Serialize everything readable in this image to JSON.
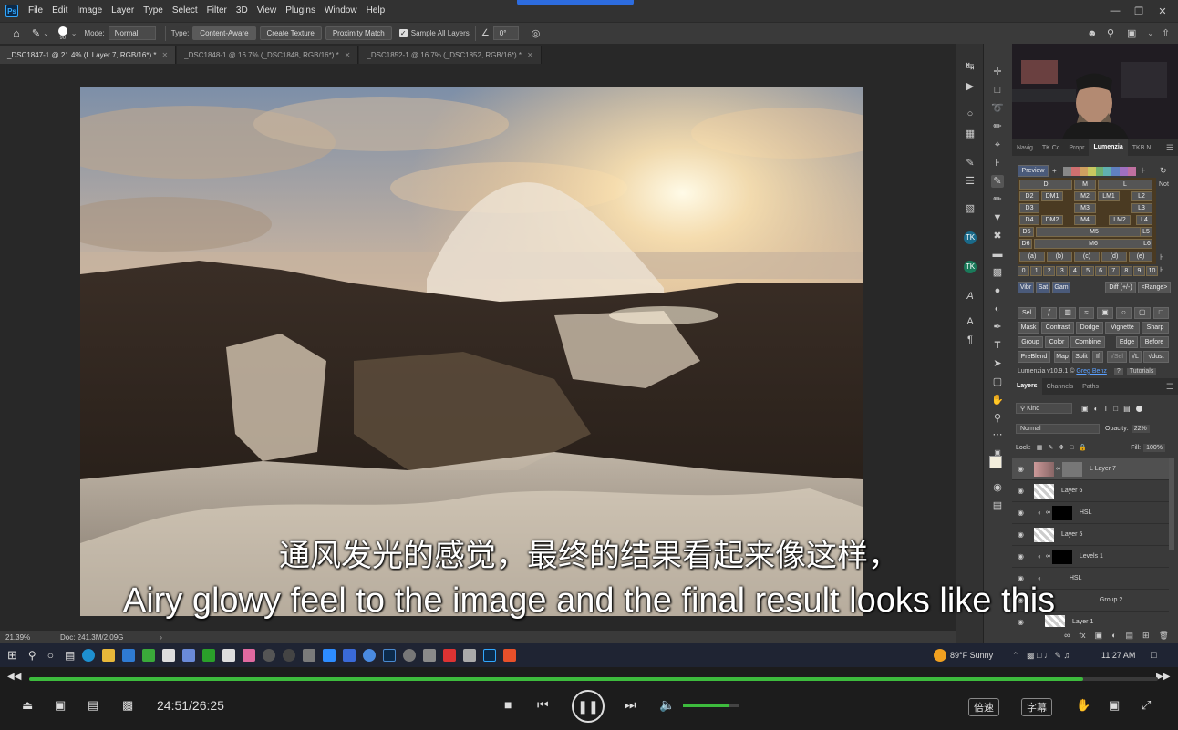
{
  "menu": {
    "logo": "Ps",
    "items": [
      "File",
      "Edit",
      "Image",
      "Layer",
      "Type",
      "Select",
      "Filter",
      "3D",
      "View",
      "Plugins",
      "Window",
      "Help"
    ]
  },
  "options": {
    "brush_size": "90",
    "mode_label": "Mode:",
    "mode_value": "Normal",
    "type_label": "Type:",
    "content_aware": "Content-Aware",
    "create_texture": "Create Texture",
    "proximity_match": "Proximity Match",
    "sample_all_layers": "Sample All Layers",
    "angle_value": "0°"
  },
  "doc_tabs": [
    {
      "label": "_DSC1847-1 @ 21.4% (L Layer 7, RGB/16*) *",
      "active": true
    },
    {
      "label": "_DSC1848-1 @ 16.7% (_DSC1848, RGB/16*) *",
      "active": false
    },
    {
      "label": "_DSC1852-1 @ 16.7% (_DSC1852, RGB/16*) *",
      "active": false
    }
  ],
  "status": {
    "zoom": "21.39%",
    "doc": "Doc: 241.3M/2.09G"
  },
  "panel_tabs_top": [
    "Navig",
    "TK Cc",
    "Propr",
    "Lumenzia",
    "TKB N"
  ],
  "lumenzia": {
    "preview": "Preview",
    "not": "Not",
    "grid_rows": [
      [
        "D",
        "M",
        "L"
      ],
      [
        "D2",
        "DM1",
        "M2",
        "LM1",
        "L2"
      ],
      [
        "D3",
        "M3",
        "L3"
      ],
      [
        "D4",
        "DM2",
        "M4",
        "LM2",
        "L4"
      ],
      [
        "D5",
        "M5",
        "L5"
      ],
      [
        "D6",
        "M6",
        "L6"
      ]
    ],
    "abc": [
      "(a)",
      "(b)",
      "(c)",
      "(d)",
      "(e)"
    ],
    "zones": [
      "0",
      "1",
      "2",
      "3",
      "4",
      "5",
      "6",
      "7",
      "8",
      "9",
      "10"
    ],
    "vibr_row": [
      "Vibr",
      "Sat",
      "Gam"
    ],
    "diff": "Diff (+/-)",
    "range": "<Range>",
    "row_a": [
      "Sel"
    ],
    "row_b": [
      "Mask",
      "Contrast",
      "Dodge",
      "Vignette",
      "Sharp"
    ],
    "row_c": [
      "Group",
      "Color",
      "Combine",
      "Edge",
      "Before"
    ],
    "row_d": [
      "PreBlend",
      "Map",
      "Split",
      "If",
      "√Sel",
      "√L",
      "√dust"
    ],
    "version": "Lumenzia v10.9.1 ©",
    "author": "Greg Benz",
    "help": "?",
    "tutorials": "Tutorials"
  },
  "layers_panel": {
    "tabs": [
      "Layers",
      "Channels",
      "Paths"
    ],
    "kind": "Kind",
    "blend": "Normal",
    "opacity_label": "Opacity:",
    "opacity": "22%",
    "lock_label": "Lock:",
    "fill_label": "Fill:",
    "fill": "100%",
    "layers": [
      "L Layer 7",
      "Layer 6",
      "HSL",
      "Layer 5",
      "Levels 1",
      "HSL",
      "Group 2",
      "Layer 1"
    ]
  },
  "subtitles": {
    "cn": "通风发光的感觉，最终的结果看起来像这样，",
    "en": "Airy glowy feel to the image and the final result looks like this"
  },
  "taskbar": {
    "weather": "89°F  Sunny",
    "time": "11:27 AM"
  },
  "player": {
    "time": "24:51/26:25",
    "progress": 0.934,
    "volume": 0.8,
    "speed_btn": "倍速",
    "subtitle_btn": "字幕"
  },
  "colors": {
    "accent_green": "#3dbb3d",
    "ps_blue": "#31a8ff",
    "taskbar": "#1f2433"
  }
}
